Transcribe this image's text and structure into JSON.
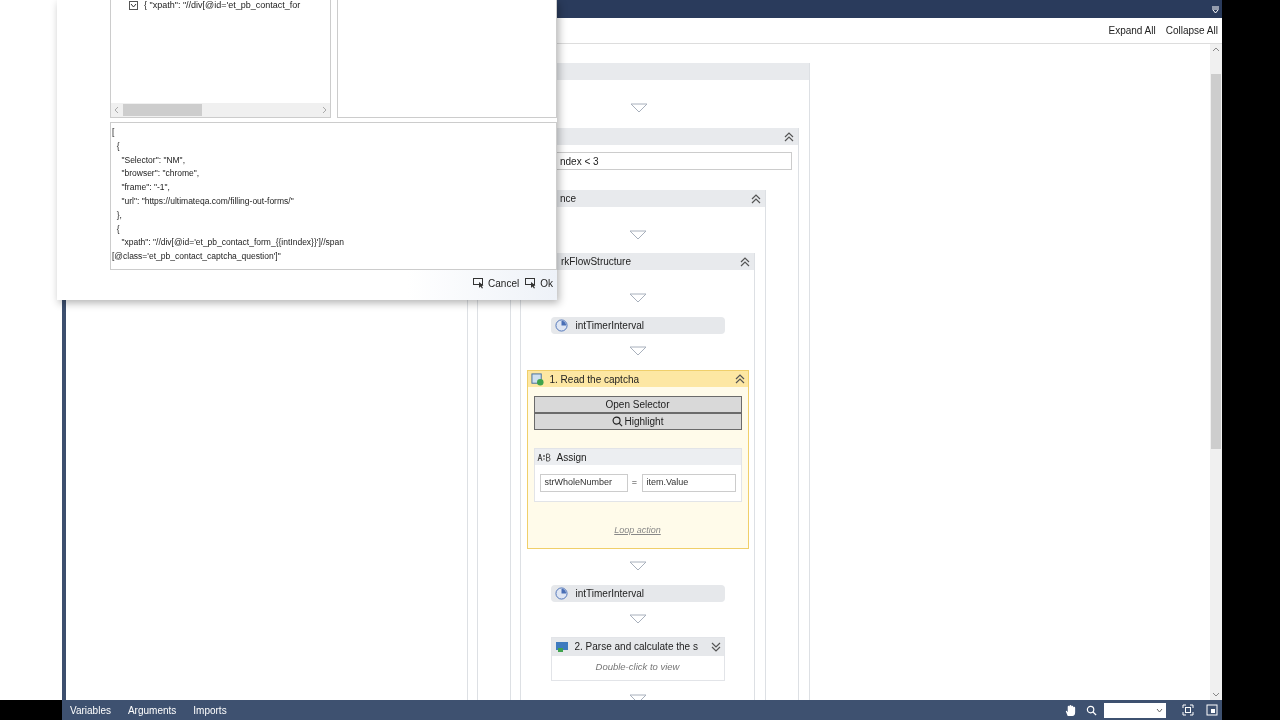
{
  "dialog": {
    "tree_row": "{   \"xpath\": \"//div[@id='et_pb_contact_for",
    "code_lines": [
      "[",
      "  {",
      "    \"Selector\": \"NM\",",
      "    \"browser\": \"chrome\",",
      "    \"frame\": \"-1\",",
      "    \"url\": \"https://ultimateqa.com/filling-out-forms/\"",
      "  },",
      "  {",
      "    \"xpath\": \"//div[@id='et_pb_contact_form_{{intIndex}}']//span",
      "[@class='et_pb_contact_captcha_question']\""
    ],
    "buttons": [
      {
        "label": "Cancel"
      },
      {
        "label": "Ok"
      }
    ]
  },
  "toolbar": {
    "buttons": [
      "Expand All",
      "Collapse All"
    ]
  },
  "designer": {
    "loop": {
      "expanded": true,
      "condition": "ndex < 3"
    },
    "sequence": {
      "title": "nce",
      "expanded": true
    },
    "structure": {
      "title": "rkFlowStructure",
      "expanded": true
    },
    "activities": [
      {
        "kind": "delay",
        "label": "intTimerInterval"
      },
      {
        "kind": "scope",
        "title": "1. Read the captcha",
        "selected": true,
        "expanded": true,
        "buttons": [
          "Open Selector",
          "Highlight"
        ],
        "assign": {
          "title": "Assign",
          "to": "strWholeNumber",
          "op": "=",
          "value": "item.Value"
        },
        "link": "Loop action"
      },
      {
        "kind": "delay",
        "label": "intTimerInterval"
      },
      {
        "kind": "sequence",
        "title": "2. Parse and calculate the s",
        "expanded": false,
        "hint": "Double-click to view"
      }
    ]
  },
  "bottom_tabs": [
    "Variables",
    "Arguments",
    "Imports"
  ]
}
